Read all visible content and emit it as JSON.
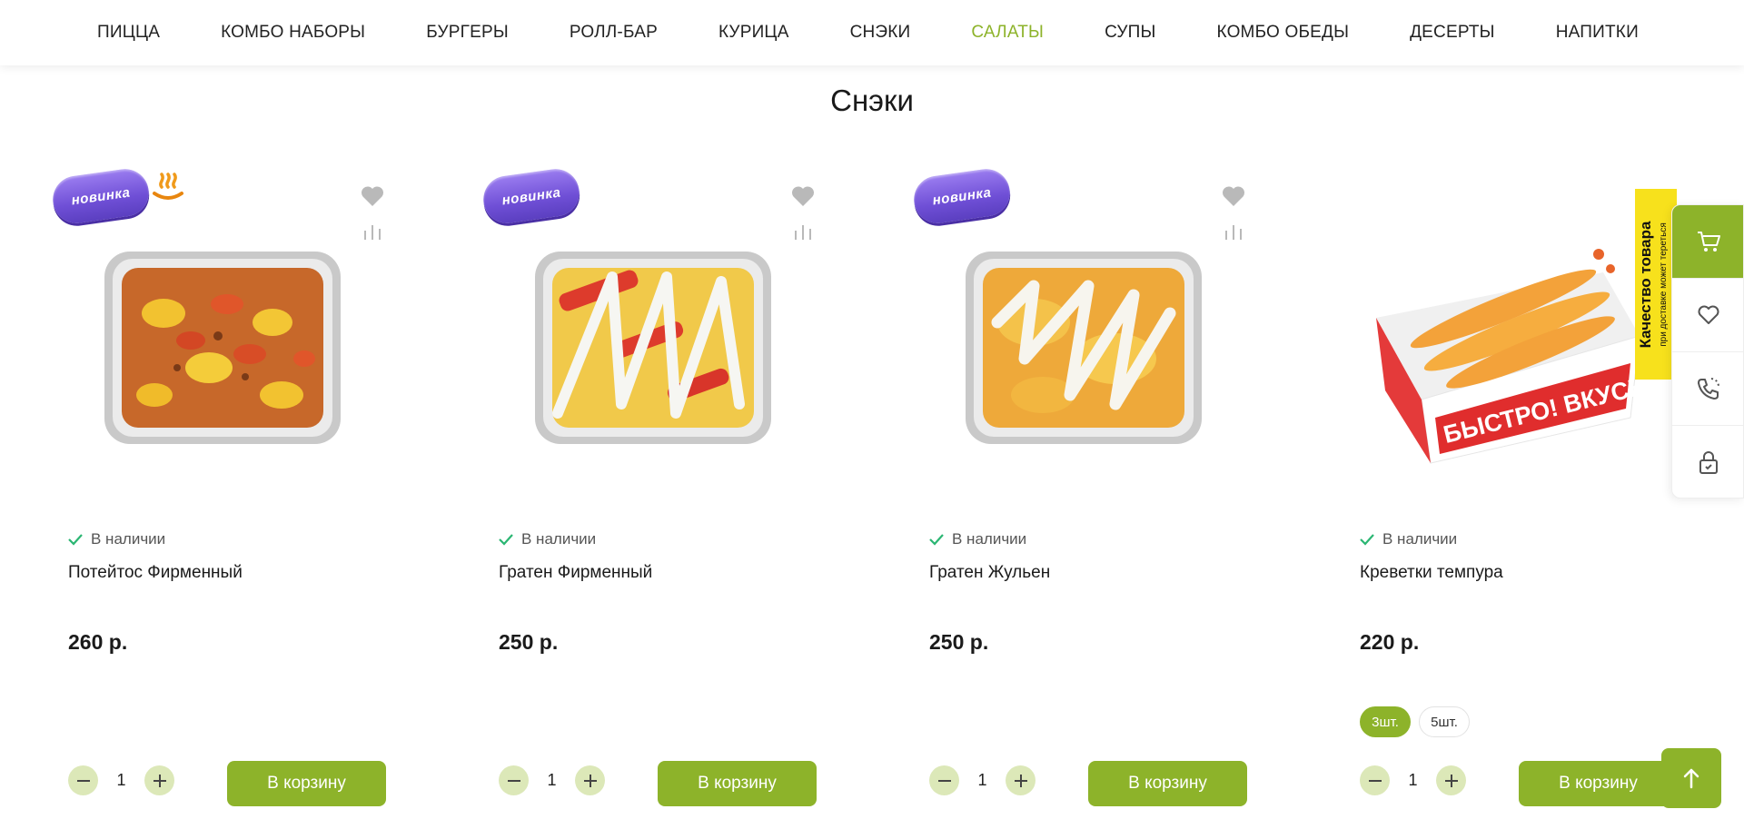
{
  "nav": {
    "items": [
      {
        "label": "ПИЦЦА",
        "active": false
      },
      {
        "label": "КОМБО НАБОРЫ",
        "active": false
      },
      {
        "label": "БУРГЕРЫ",
        "active": false
      },
      {
        "label": "РОЛЛ-БАР",
        "active": false
      },
      {
        "label": "КУРИЦА",
        "active": false
      },
      {
        "label": "СНЭКИ",
        "active": false
      },
      {
        "label": "САЛАТЫ",
        "active": true
      },
      {
        "label": "СУПЫ",
        "active": false
      },
      {
        "label": "КОМБО ОБЕДЫ",
        "active": false
      },
      {
        "label": "ДЕСЕРТЫ",
        "active": false
      },
      {
        "label": "НАПИТКИ",
        "active": false
      }
    ]
  },
  "section": {
    "title": "Снэки"
  },
  "badge": {
    "new_label": "новинка"
  },
  "stock_label": "В наличии",
  "cart_button_label": "В корзину",
  "colors": {
    "accent": "#8db32a",
    "accent_light": "#dce8b8",
    "badge_purple": "#6f4fd6",
    "check_green": "#2bb673"
  },
  "products": [
    {
      "name": "Потейтос Фирменный",
      "price": "260 р.",
      "qty": "1",
      "is_new": true,
      "hot": true
    },
    {
      "name": "Гратен Фирменный",
      "price": "250 р.",
      "qty": "1",
      "is_new": true,
      "hot": false
    },
    {
      "name": "Гратен Жульен",
      "price": "250 р.",
      "qty": "1",
      "is_new": true,
      "hot": false
    },
    {
      "name": "Креветки темпура",
      "price": "220 р.",
      "qty": "1",
      "is_new": false,
      "hot": false,
      "options": [
        {
          "label": "3шт.",
          "selected": true
        },
        {
          "label": "5шт.",
          "selected": false
        }
      ],
      "box_text": "БЫСТРО! ВКУСНО!"
    }
  ],
  "quality_badge": {
    "line1": "Качество товара",
    "line2": "при доставке может тереться"
  },
  "side_panel": {
    "icons": [
      "cart-icon",
      "heart-icon",
      "phone-icon",
      "lock-icon"
    ]
  }
}
